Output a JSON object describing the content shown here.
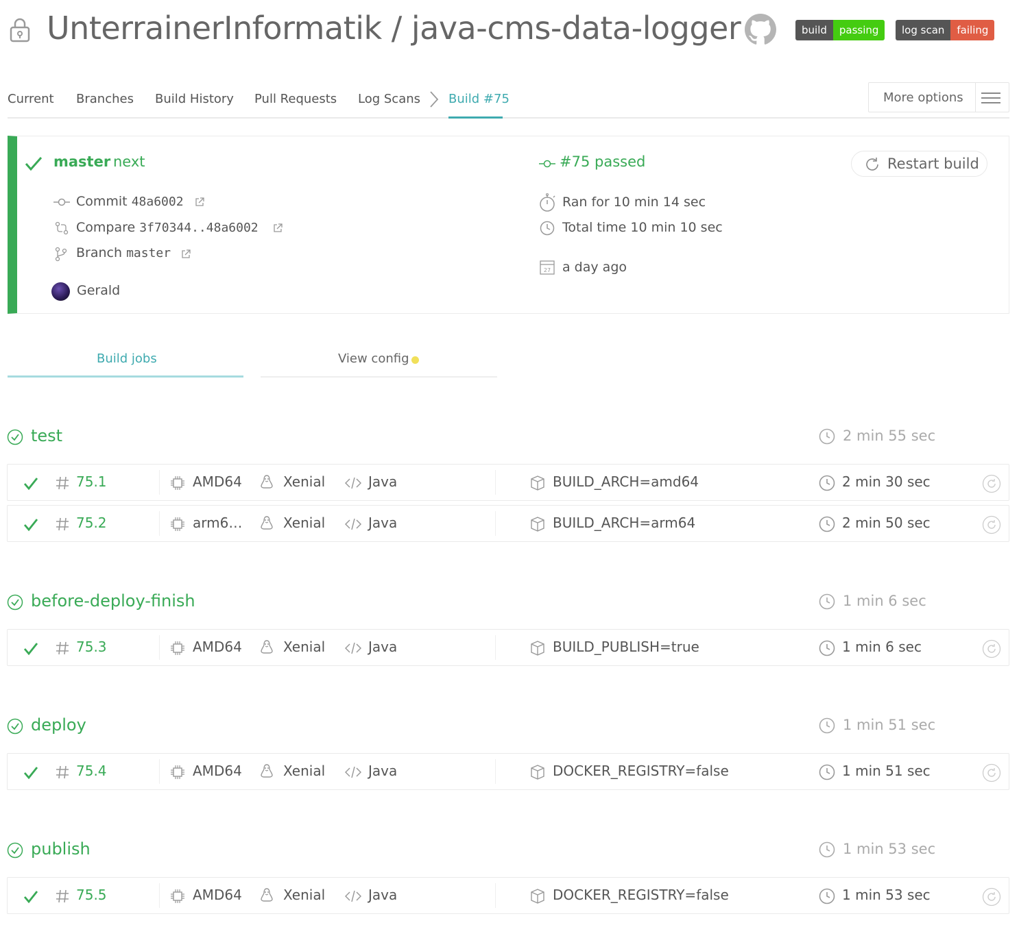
{
  "header": {
    "repo_title": "UnterrainerInformatik / java-cms-data-logger",
    "badges": [
      {
        "left": "build",
        "right": "passing",
        "right_color": "#44cc11"
      },
      {
        "left": "log scan",
        "right": "failing",
        "right_color": "#e05d44"
      }
    ]
  },
  "nav": {
    "items": [
      "Current",
      "Branches",
      "Build History",
      "Pull Requests",
      "Log Scans"
    ],
    "active": "Build #75",
    "more_options": "More options"
  },
  "summary": {
    "branch": "master",
    "message": "next",
    "commit_label": "Commit",
    "commit": "48a6002",
    "compare_label": "Compare",
    "compare": "3f70344..48a6002",
    "branch_label": "Branch",
    "branch_value": "master",
    "author": "Gerald",
    "status": "#75 passed",
    "ran_for": "Ran for 10 min 14 sec",
    "total_time": "Total time 10 min 10 sec",
    "when": "a day ago",
    "calendar_day": "27",
    "restart": "Restart build"
  },
  "tabs": {
    "build_jobs": "Build jobs",
    "view_config": "View config"
  },
  "stages": [
    {
      "name": "test",
      "time": "2 min 55 sec",
      "jobs": [
        {
          "num": "75.1",
          "arch": "AMD64",
          "os": "Xenial",
          "lang": "Java",
          "env": "BUILD_ARCH=amd64",
          "time": "2 min 30 sec"
        },
        {
          "num": "75.2",
          "arch": "arm6…",
          "os": "Xenial",
          "lang": "Java",
          "env": "BUILD_ARCH=arm64",
          "time": "2 min 50 sec"
        }
      ]
    },
    {
      "name": "before-deploy-finish",
      "time": "1 min 6 sec",
      "jobs": [
        {
          "num": "75.3",
          "arch": "AMD64",
          "os": "Xenial",
          "lang": "Java",
          "env": "BUILD_PUBLISH=true",
          "time": "1 min 6 sec"
        }
      ]
    },
    {
      "name": "deploy",
      "time": "1 min 51 sec",
      "jobs": [
        {
          "num": "75.4",
          "arch": "AMD64",
          "os": "Xenial",
          "lang": "Java",
          "env": "DOCKER_REGISTRY=false",
          "time": "1 min 51 sec"
        }
      ]
    },
    {
      "name": "publish",
      "time": "1 min 53 sec",
      "jobs": [
        {
          "num": "75.5",
          "arch": "AMD64",
          "os": "Xenial",
          "lang": "Java",
          "env": "DOCKER_REGISTRY=false",
          "time": "1 min 53 sec"
        }
      ]
    }
  ],
  "colors": {
    "passed": "#39aa56",
    "accent": "#3eaaaf",
    "config_dot": "#f1e05a"
  }
}
